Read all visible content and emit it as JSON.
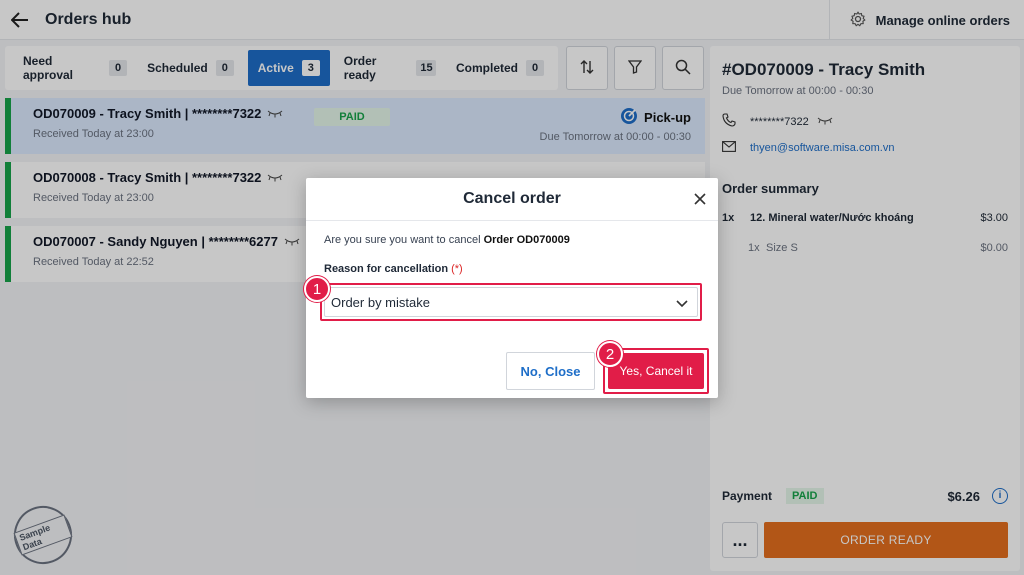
{
  "header": {
    "title": "Orders hub",
    "manage_label": "Manage online orders"
  },
  "tabs": [
    {
      "label": "Need approval",
      "count": "0"
    },
    {
      "label": "Scheduled",
      "count": "0"
    },
    {
      "label": "Active",
      "count": "3"
    },
    {
      "label": "Order ready",
      "count": "15"
    },
    {
      "label": "Completed",
      "count": "0"
    }
  ],
  "orders": [
    {
      "title": "OD070009 - Tracy Smith | ********7322",
      "received": "Received Today at 23:00",
      "status": "PAID",
      "method": "Pick-up",
      "due": "Due Tomorrow at 00:00 - 00:30"
    },
    {
      "title": "OD070008 - Tracy Smith | ********7322",
      "received": "Received Today at 23:00"
    },
    {
      "title": "OD070007 - Sandy Nguyen | ********6277",
      "received": "Received Today at 22:52"
    }
  ],
  "detail": {
    "title": "#OD070009 - Tracy Smith",
    "due": "Due Tomorrow at 00:00 - 00:30",
    "phone": "********7322",
    "email": "thyen@software.misa.com.vn",
    "summary_title": "Order summary",
    "items": [
      {
        "qty": "1x",
        "name": "12. Mineral water/Nước khoáng",
        "price": "$3.00"
      },
      {
        "qty": "1x",
        "name": "Size S",
        "price": "$0.00"
      }
    ],
    "payment_label": "Payment",
    "payment_status": "PAID",
    "payment_total": "$6.26",
    "more_label": "...",
    "order_ready_label": "ORDER READY"
  },
  "modal": {
    "title": "Cancel order",
    "confirm_prefix": "Are you sure you want to cancel ",
    "confirm_order": "Order OD070009",
    "reason_label": "Reason for cancellation",
    "required_mark": "(*)",
    "reason_value": "Order by mistake",
    "close_button": "No, Close",
    "cancel_button": "Yes, Cancel it"
  },
  "callouts": [
    "1",
    "2"
  ],
  "watermark": "Sample Data",
  "colors": {
    "accent": "#1e6ec8",
    "paid_green": "#16a34a",
    "danger": "#e11d48",
    "order_ready": "#e46f1e"
  }
}
